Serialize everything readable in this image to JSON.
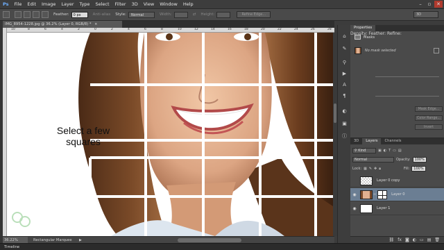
{
  "menu": [
    "File",
    "Edit",
    "Image",
    "Layer",
    "Type",
    "Select",
    "Filter",
    "3D",
    "View",
    "Window",
    "Help"
  ],
  "options": {
    "feather_label": "Feather:",
    "feather_value": "0 px",
    "anti_alias": "Anti-alias",
    "style_label": "Style:",
    "style_value": "Normal",
    "width_label": "Width:",
    "height_label": "Height:",
    "refine_edge": "Refine Edge...",
    "workspace": "3D"
  },
  "document": {
    "tab_title": "IMG_8954-1228.jpg @ 36.2% (Layer 0, RGB/8) *",
    "zoom": "36.22%",
    "tool_name": "Rectangular Marquee",
    "overlay_text_1": "Select a few",
    "overlay_text_2": "squares",
    "ruler_ticks": [
      "10",
      "8",
      "6",
      "4",
      "2",
      "0",
      "2",
      "4",
      "6",
      "8",
      "10",
      "12",
      "14",
      "16",
      "18",
      "20",
      "22",
      "24",
      "26",
      "28"
    ]
  },
  "timeline_label": "Timeline",
  "properties": {
    "tab": "Properties",
    "section": "Masks",
    "mask_status": "No mask selected",
    "density_label": "Density:",
    "feather_label": "Feather:",
    "refine_label": "Refine:",
    "mask_edge_btn": "Mask Edge...",
    "color_range_btn": "Color Range...",
    "invert_btn": "Invert"
  },
  "layers_panel": {
    "tabs": [
      "3D",
      "Layers",
      "Channels"
    ],
    "filter_kind": "Kind",
    "blend_mode": "Normal",
    "opacity_label": "Opacity:",
    "opacity_value": "100%",
    "lock_label": "Lock:",
    "fill_label": "Fill:",
    "fill_value": "100%",
    "layers": [
      {
        "name": "Layer 0 copy",
        "visible": false,
        "selected": false
      },
      {
        "name": "Layer 0",
        "visible": true,
        "selected": true
      },
      {
        "name": "Layer 1",
        "visible": true,
        "selected": false
      }
    ]
  },
  "colors": {
    "selected_layer": "#6b7e93",
    "panel_bg": "#4a4a4a",
    "close_button": "#b03a2e"
  }
}
